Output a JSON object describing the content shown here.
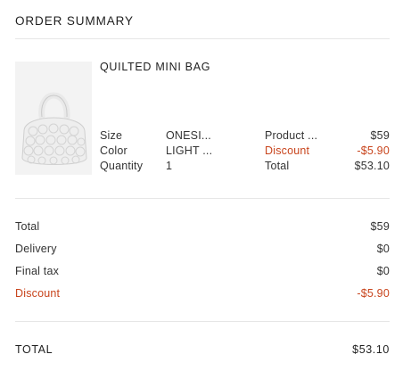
{
  "header": {
    "title": "ORDER SUMMARY"
  },
  "product": {
    "name": "QUILTED MINI BAG",
    "image_icon": "quilted-bag-image",
    "attributes": [
      {
        "label": "Size",
        "value": "ONESI..."
      },
      {
        "label": "Color",
        "value": "LIGHT ..."
      },
      {
        "label": "Quantity",
        "value": "1"
      }
    ],
    "pricing": [
      {
        "label": "Product ...",
        "value": "$59"
      },
      {
        "label": "Discount",
        "value": "-$5.90"
      },
      {
        "label": "Total",
        "value": "$53.10"
      }
    ]
  },
  "summary": {
    "rows": [
      {
        "label": "Total",
        "value": "$59"
      },
      {
        "label": "Delivery",
        "value": "$0"
      },
      {
        "label": "Final tax",
        "value": "$0"
      },
      {
        "label": "Discount",
        "value": "-$5.90"
      }
    ],
    "grand_total": {
      "label": "TOTAL",
      "value": "$53.10"
    }
  },
  "colors": {
    "discount": "#c8441c",
    "divider": "#e6e6e6",
    "thumb_bg": "#f3f3f3"
  }
}
